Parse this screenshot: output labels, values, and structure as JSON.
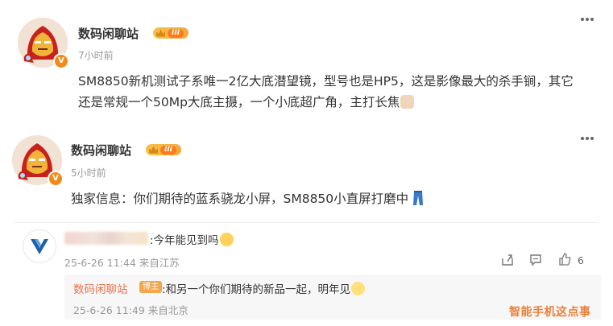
{
  "posts": [
    {
      "username": "数码闲聊站",
      "level": "III",
      "time": "7小时前",
      "text": "SM8850新机测试子系唯一2亿大底潜望镜，型号也是HP5，这是影像最大的杀手锏，其它还是常规一个50Mp大底主摄，一个小底超广角，主打长焦",
      "verified": "V"
    },
    {
      "username": "数码闲聊站",
      "level": "III",
      "time": "5小时前",
      "text": "独家信息：你们期待的蓝系骁龙小屏，SM8850小直屏打磨中",
      "verified": "V"
    }
  ],
  "comment": {
    "text": ":今年能见到吗",
    "meta": "25-6-26 11:44 来自江苏",
    "like_count": "6",
    "icons": [
      "share-icon",
      "comment-icon",
      "like-icon"
    ]
  },
  "reply": {
    "username": "数码闲聊站",
    "tag": "博主",
    "text": ":和另一个你们期待的新品一起，明年见",
    "meta": "25-6-26 11:49 来自北京"
  },
  "watermark": "智能手机这点事",
  "colors": {
    "name_link": "#eb7350",
    "meta_gray": "#999999",
    "badge_orange": "#f28a1a",
    "watermark": "#eb7f38"
  }
}
